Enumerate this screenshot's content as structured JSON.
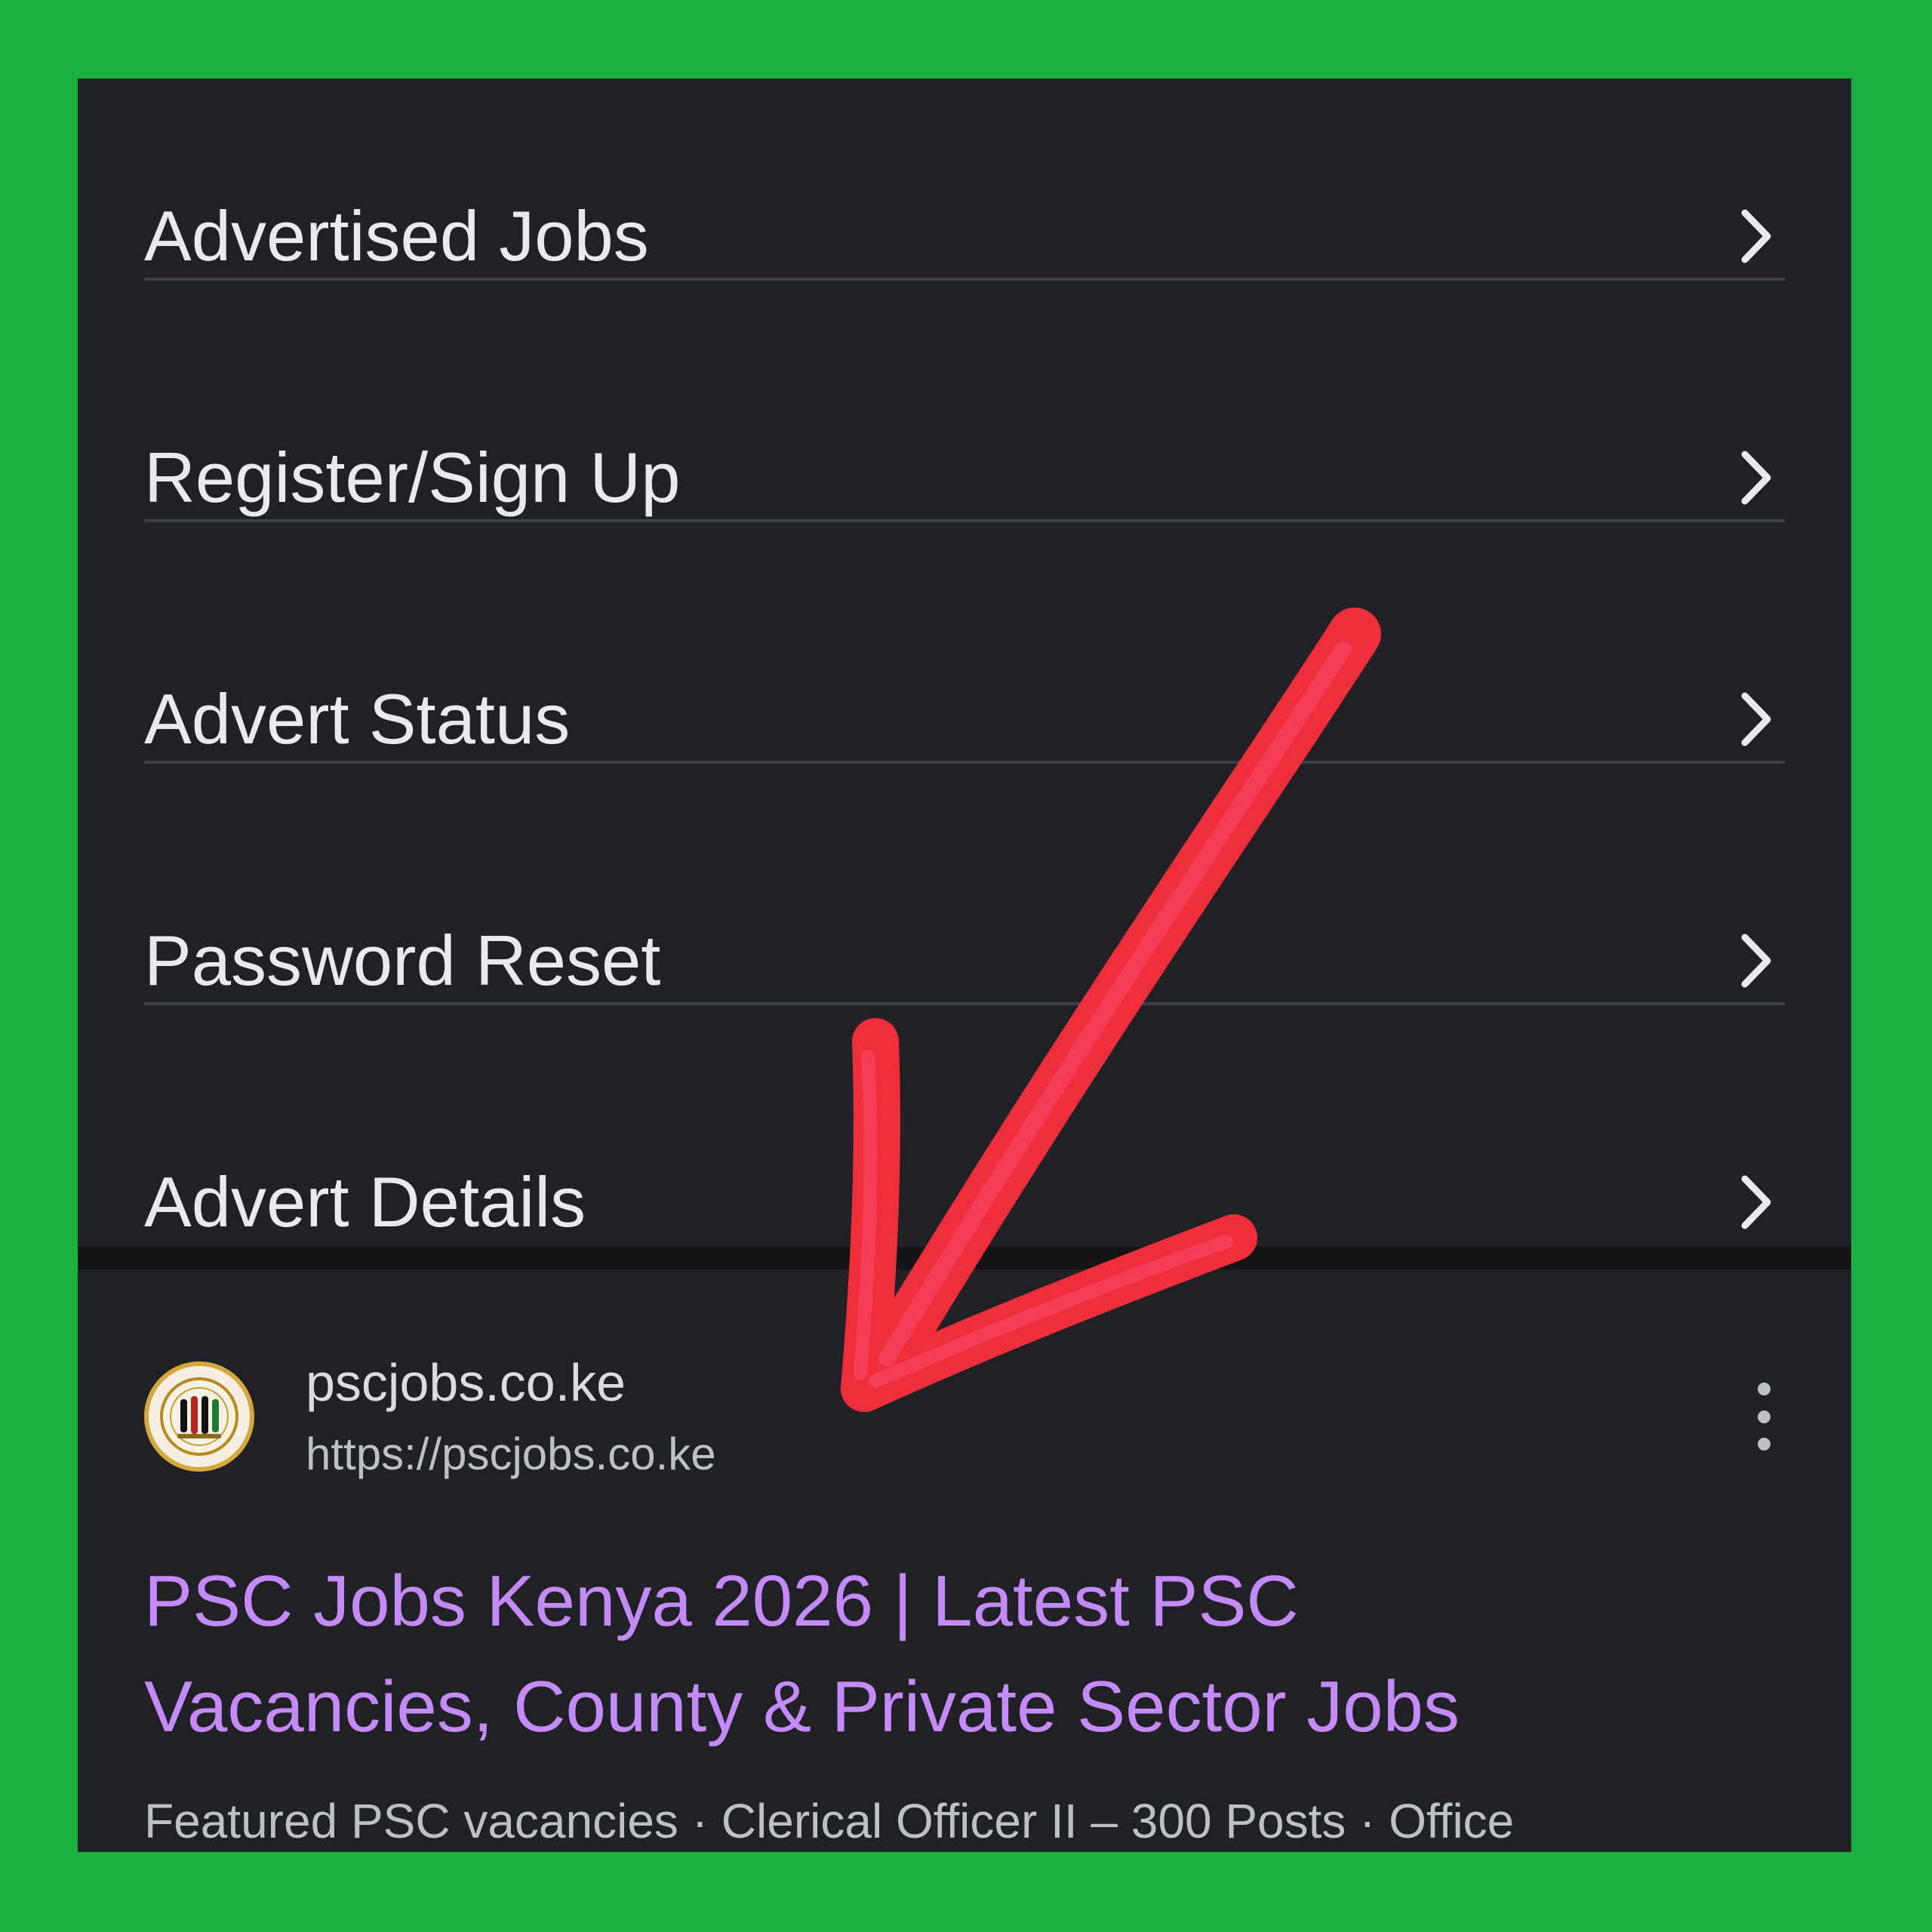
{
  "menu": {
    "items": [
      {
        "label": "Advertised Jobs"
      },
      {
        "label": "Register/Sign Up"
      },
      {
        "label": "Advert Status"
      },
      {
        "label": "Password Reset"
      },
      {
        "label": "Advert Details"
      }
    ]
  },
  "result": {
    "site_name": "pscjobs.co.ke",
    "site_url": "https://pscjobs.co.ke",
    "title_line1": "PSC Jobs Kenya 2026 | Latest PSC",
    "title_line2": "Vacancies, County & Private Sector Jobs",
    "snippet": "Featured PSC vacancies · Clerical Officer II – 300 Posts · Office"
  },
  "colors": {
    "border": "#1bb141",
    "background": "#202124",
    "link": "#c58af9",
    "annotation_arrow": "#f0303a"
  },
  "icons": {
    "chevron": "chevron-right-icon",
    "more": "more-vert-icon",
    "favicon": "psc-logo-icon",
    "annotation": "red-arrow-annotation"
  }
}
